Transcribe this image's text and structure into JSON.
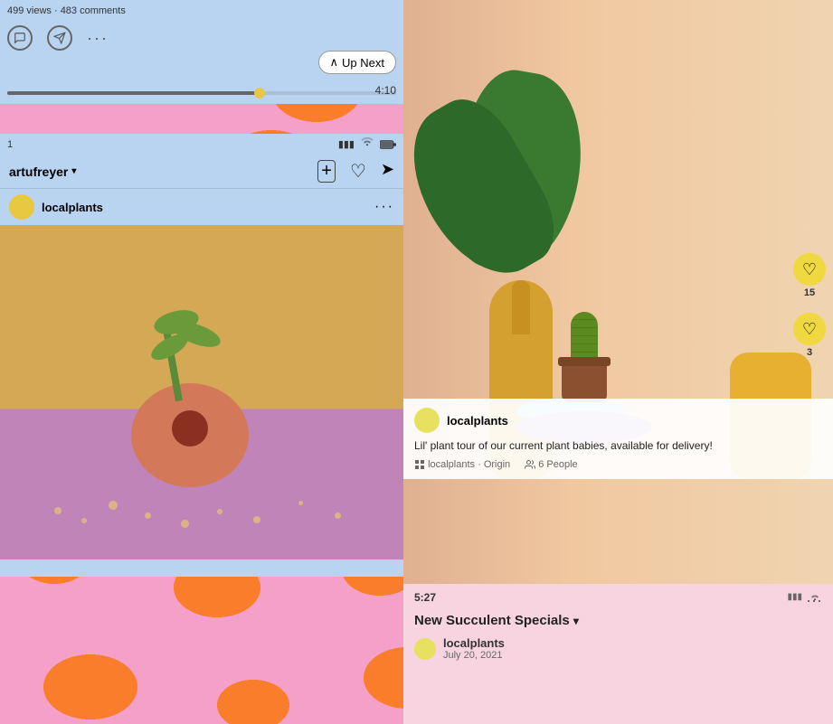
{
  "video_top": {
    "stats": "499 views · 483 comments",
    "time": "4:10",
    "up_next_label": "Up Next"
  },
  "insta_card": {
    "username": "artufreyer",
    "post_username": "localplants",
    "dots": "···"
  },
  "right_overlay": {
    "username": "localplants",
    "caption": "Lil' plant tour of our current plant babies, available for delivery!",
    "meta1": "localplants · Origin",
    "meta2": "6 People"
  },
  "bottom_video": {
    "time": "5:27",
    "title": "New Succulent Specials",
    "username": "localplants",
    "date": "July 20, 2021",
    "more": "···"
  },
  "reactions": [
    {
      "icon": "♡",
      "count": "15",
      "color": "#f0d840"
    },
    {
      "icon": "♡",
      "count": "3",
      "color": "#f0d840"
    }
  ],
  "nav_icons": [
    {
      "name": "home",
      "symbol": "⌂"
    },
    {
      "name": "search",
      "symbol": "⌕"
    },
    {
      "name": "play",
      "symbol": "▷"
    },
    {
      "name": "shop",
      "symbol": "⊡"
    },
    {
      "name": "profile",
      "symbol": "◯"
    }
  ]
}
